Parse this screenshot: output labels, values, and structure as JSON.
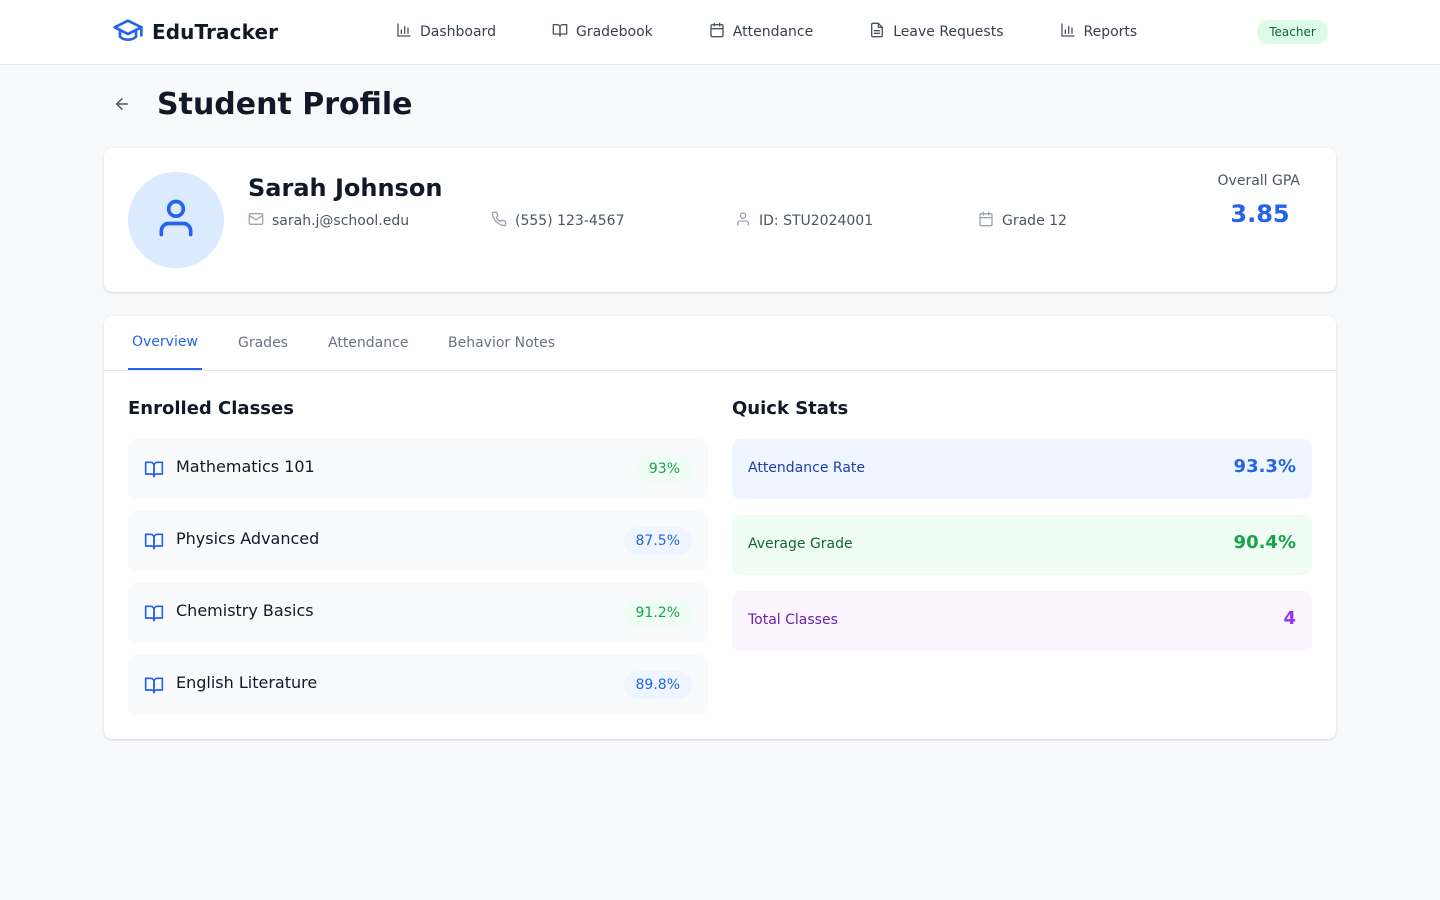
{
  "colors": {
    "primary": "#2563eb",
    "green": "#16a34a",
    "purple": "#9333ea",
    "background": "#f8f9fb"
  },
  "header": {
    "brand_icon": "graduation-cap-icon",
    "brand_name": "EduTracker",
    "nav": [
      {
        "label": "Dashboard",
        "icon": "bar-chart-icon"
      },
      {
        "label": "Gradebook",
        "icon": "book-open-icon"
      },
      {
        "label": "Attendance",
        "icon": "calendar-icon"
      },
      {
        "label": "Leave Requests",
        "icon": "file-text-icon"
      },
      {
        "label": "Reports",
        "icon": "bar-chart-icon"
      }
    ],
    "role_badge": "Teacher"
  },
  "page": {
    "back_icon": "arrow-left-icon",
    "title": "Student Profile"
  },
  "profile": {
    "avatar_icon": "user-icon",
    "name": "Sarah Johnson",
    "email": "sarah.j@school.edu",
    "phone": "(555) 123-4567",
    "student_id": "ID: STU2024001",
    "grade": "Grade 12",
    "gpa_label": "Overall GPA",
    "gpa_value": "3.85"
  },
  "tabs": [
    "Overview",
    "Grades",
    "Attendance",
    "Behavior Notes"
  ],
  "active_tab": "Overview",
  "enrolled": {
    "title": "Enrolled Classes",
    "classes": [
      {
        "name": "Mathematics 101",
        "grade": "93%",
        "tone": "green"
      },
      {
        "name": "Physics Advanced",
        "grade": "87.5%",
        "tone": "blue"
      },
      {
        "name": "Chemistry Basics",
        "grade": "91.2%",
        "tone": "green"
      },
      {
        "name": "English Literature",
        "grade": "89.8%",
        "tone": "blue"
      }
    ]
  },
  "quick_stats": {
    "title": "Quick Stats",
    "stats": [
      {
        "label": "Attendance Rate",
        "value": "93.3%",
        "tone": "blue"
      },
      {
        "label": "Average Grade",
        "value": "90.4%",
        "tone": "green"
      },
      {
        "label": "Total Classes",
        "value": "4",
        "tone": "purple"
      }
    ]
  }
}
